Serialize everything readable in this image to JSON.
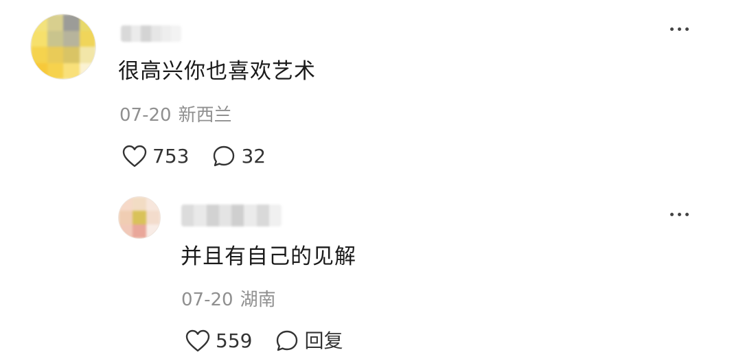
{
  "comments": [
    {
      "text": "很高兴你也喜欢艺术",
      "date": "07-20",
      "location": "新西兰",
      "likes": "753",
      "replies": "32",
      "avatar_icon": "blurred-avatar-icon",
      "avatar_colors": [
        "#f3e27c",
        "#d8cf8e",
        "#9c9c98",
        "#e8d96a",
        "#f6e06c",
        "#c9c48d",
        "#b7b49c",
        "#f0d55a",
        "#f5d34e",
        "#e9cb58",
        "#d9c465",
        "#f2e6a8",
        "#f7c93a",
        "#f6d24d",
        "#f9e07a",
        "#fbf2d2"
      ],
      "name_colors": [
        "#d9d9d9",
        "#ebebeb",
        "#d4d4d4",
        "#e6e6e6",
        "#eeeeee",
        "#f3f3f3"
      ]
    },
    {
      "text": "并且有自己的见解",
      "date": "07-20",
      "location": "湖南",
      "likes": "559",
      "reply_label": "回复",
      "avatar_icon": "blurred-avatar-icon",
      "avatar_colors": [
        "#f6d9c8",
        "#f2dcc4",
        "#f7e6dc",
        "#f0cdb3",
        "#d9c25a",
        "#f3dccc",
        "#f1c9b9",
        "#e9a79a",
        "#f8ece6"
      ],
      "name_colors": [
        "#dcdcdc",
        "#e9e9e9",
        "#d2d2d2",
        "#e4e4e4",
        "#cfcfcf",
        "#ebebeb",
        "#d9d9d9",
        "#f0f0f0"
      ]
    }
  ],
  "icons": {
    "more": "more-dots-icon",
    "like": "heart-outline-icon",
    "comment": "comment-bubble-icon"
  },
  "colors": {
    "text": "#1a1a1a",
    "meta": "#8f8f8f",
    "icon": "#333333"
  }
}
